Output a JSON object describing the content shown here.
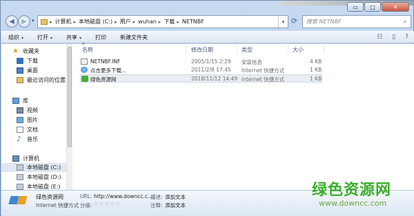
{
  "window": {
    "desktop_strip_text": "",
    "caption": {
      "minimize": "▭",
      "maximize": "□",
      "close": "✕"
    }
  },
  "navigation": {
    "back_icon": "arrow-left-icon",
    "forward_icon": "arrow-right-icon",
    "breadcrumbs": [
      "计算机",
      "本地磁盘 (C:)",
      "用户",
      "wuhan",
      "下载",
      "NETNBF"
    ],
    "search_placeholder": "搜索 NETNBF"
  },
  "toolbar": {
    "organize": "组织",
    "open": "打开",
    "share": "共享",
    "print": "打印",
    "new_folder": "新建文件夹"
  },
  "sidebar": {
    "favorites": "收藏夹",
    "favorites_items": [
      "下载",
      "桌面",
      "最近访问的位置"
    ],
    "libraries": "库",
    "libraries_items": [
      "视频",
      "图片",
      "文档",
      "音乐"
    ],
    "computer": "计算机",
    "computer_items": [
      "本地磁盘 (C:)",
      "本地磁盘 (D:)",
      "本地磁盘 (E:)"
    ]
  },
  "file_list": {
    "columns": [
      "名称",
      "修改日期",
      "类型",
      "大小"
    ],
    "rows": [
      {
        "name": "NETNBF.INF",
        "date": "2005/1/15 2:29",
        "type": "安装信息",
        "size": "4 KB",
        "icon": "inf-file-icon"
      },
      {
        "name": "点击更多下载...",
        "date": "2011/2/8 17:45",
        "type": "Internet 快捷方式",
        "size": "1 KB",
        "icon": "internet-shortcut-icon"
      },
      {
        "name": "绿色资源网",
        "date": "2018/11/12 14:49",
        "type": "Internet 快捷方式",
        "size": "1 KB",
        "icon": "green-site-icon"
      }
    ]
  },
  "details": {
    "name": "绿色资源网",
    "type": "Internet 快捷方式",
    "url_label": "URL:",
    "url_value": "http://www.downcc.c...",
    "rating_label": "分级:",
    "rating_stars": "☆☆☆☆☆",
    "desc_label": "描述:",
    "desc_value": "添加文本",
    "comment_label": "注释:",
    "comment_value": "添加文本"
  },
  "watermark": {
    "cn": "绿色资源网",
    "url": "www.downcc.com"
  }
}
